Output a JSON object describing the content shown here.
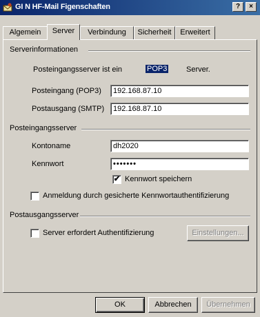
{
  "window": {
    "title": "GI N HF-Mail Figenschaften",
    "help_button": "?",
    "close_button": "×"
  },
  "tabs": [
    {
      "label": "Algemein"
    },
    {
      "label": "Server"
    },
    {
      "label": "Verbindung"
    },
    {
      "label": "Sicherheit"
    },
    {
      "label": "Erweitert"
    }
  ],
  "server_info": {
    "heading": "Serverinformationen",
    "incoming_type_label_prefix": "Posteingangsserver ist ein",
    "incoming_type_value": "POP3",
    "incoming_type_label_suffix": "Server.",
    "incoming_label": "Posteingang (POP3)",
    "incoming_value": "192.168.87.10",
    "outgoing_label": "Postausgang (SMTP)",
    "outgoing_value": "192.168.87.10"
  },
  "incoming_server": {
    "heading": "Posteingangsserver",
    "account_label": "Kontoname",
    "account_value": "dh2020",
    "password_label": "Kennwort",
    "password_value": "•••••••",
    "remember_label": "Kennwort speichern",
    "remember_checked": "✔",
    "spa_label": "Anmeldung durch gesicherte Kennwortauthentifizierung",
    "spa_checked": ""
  },
  "outgoing_server": {
    "heading": "Postausgangsserver",
    "auth_label": "Server erfordert Authentifizierung",
    "auth_checked": "",
    "settings_button": "Einstellungen..."
  },
  "footer": {
    "ok": "OK",
    "cancel": "Abbrechen",
    "apply": "Übernehmen"
  }
}
